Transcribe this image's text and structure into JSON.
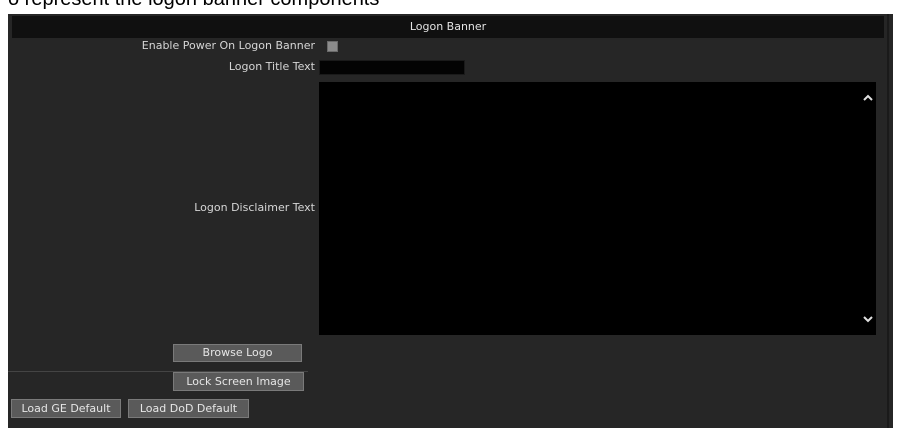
{
  "header": {
    "partial_text": "o represent the logon banner components"
  },
  "panel": {
    "title": "Logon Banner",
    "enable_label": "Enable Power On Logon Banner",
    "enable_checked": false,
    "title_text_label": "Logon Title Text",
    "title_text_value": "",
    "disclaimer_label": "Logon Disclaimer Text",
    "disclaimer_value": "",
    "scroll_up_icon": "chevron-up-icon",
    "scroll_down_icon": "chevron-down-icon"
  },
  "buttons": {
    "browse_logo": "Browse Logo",
    "lock_screen_image": "Lock Screen Image",
    "load_ge_default": "Load GE Default",
    "load_dod_default": "Load DoD Default"
  }
}
